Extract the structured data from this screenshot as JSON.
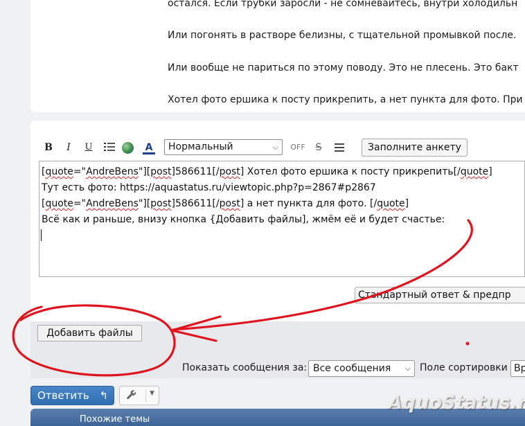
{
  "post": {
    "lines": [
      "остался. Если трубки заросли - не сомневайтесь, внутри холодильн",
      "Или погонять в растворе белизны, с тщательной промывкой после.",
      "Или вообще не париться по этому поводу. Это не плесень. Это бакт",
      "Хотел фото ершика к посту прикрепить, а нет пункта для фото. При"
    ]
  },
  "toolbar": {
    "bold": "B",
    "italic": "I",
    "underline": "U",
    "list_icon": "list-icon",
    "globe_icon": "globe-icon",
    "color": "A",
    "font_size_value": "Нормальный",
    "off": "OFF",
    "strike": "S",
    "align_icon": "align-icon",
    "survey_button": "Заполните анкету"
  },
  "editor": {
    "line1": {
      "q": "quote",
      "eq": "=\"",
      "author": "AndreBens",
      "mid": "\"][",
      "post": "post",
      "num": "]586611[/",
      "post2": "post",
      "text": "] Хотел фото ершика к посту прикрепить[/",
      "qend": "quote",
      "close": "]"
    },
    "line2": "Тут есть фото: https://aquastatus.ru/viewtopic.php?p=2867#p2867",
    "line3": {
      "q": "quote",
      "eq": "=\"",
      "author": "AndreBens",
      "mid": "\"][",
      "post": "post",
      "num": "]586611[/",
      "post2": "post",
      "text": "]  а нет пункта для фото. [/",
      "qend": "quote",
      "close": "]"
    },
    "line4": "Всё как и раньше, внизу кнопка {Добавить файлы], жмём её и будет счастье:"
  },
  "standard_reply_button": "Стандартный ответ & предпр",
  "add_files_button": "Добавить файлы",
  "options": {
    "show_label": "Показать сообщения за:",
    "show_value": "Все сообщения",
    "sort_label": "Поле сортировки",
    "sort_value": "Вр"
  },
  "actions": {
    "reply_label": "Ответить",
    "reply_icon": "reply-arrow-icon",
    "tools_icon": "wrench-icon"
  },
  "similar_topics": "Похожие темы",
  "watermark": "AquoStatus.ru",
  "colors": {
    "annotation_red": "#e0141e",
    "reply_blue": "#2f6db0",
    "header_blue": "#4a70a3"
  }
}
